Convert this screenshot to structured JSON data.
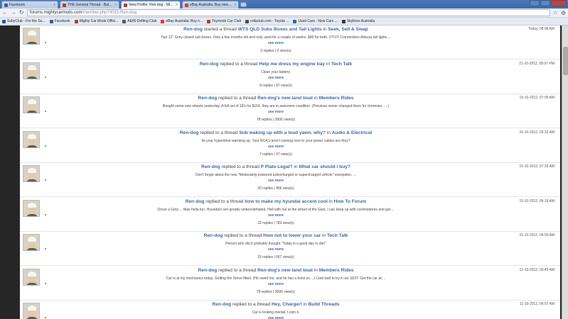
{
  "browser": {
    "tabs": [
      {
        "title": "Facebook",
        "color": "#3b5998"
      },
      {
        "title": "THE General Thread - Baltsy",
        "color": "#b03a2e"
      },
      {
        "title": "View Profile: Ren-dog - Mighty",
        "color": "#b03a2e"
      },
      {
        "title": "eBay Australia: Buy new & u",
        "color": "#e53238"
      }
    ],
    "url_host": "forums.mightycarmods.com",
    "url_path": "/member.php?3032-Ren-dog",
    "bookmarks": [
      {
        "label": "SubyClub - For the Su...",
        "color": "#2a4f9e"
      },
      {
        "label": "Facebook",
        "color": "#3b5998"
      },
      {
        "label": "Mighty Car Mods Offici...",
        "color": "#b03a2e"
      },
      {
        "label": "AE86 Drifting Club",
        "color": "#555555"
      },
      {
        "label": "eBay Australia: Buy n...",
        "color": "#e53238"
      },
      {
        "label": "Toymods Car Club",
        "color": "#c0392b"
      },
      {
        "label": "rollaclub.com - Toyota ...",
        "color": "#4a4a4a"
      },
      {
        "label": "Used Cars - New Cars ...",
        "color": "#1a6fb5"
      },
      {
        "label": "Skylines Australia",
        "color": "#333333"
      }
    ]
  },
  "feed": [
    {
      "user": "Ren-dog",
      "verb": " started a thread ",
      "thread": "WTS QLD Subs Boxes and Tail Lights",
      "in": " in ",
      "forum": "Seek, Sell & Swap",
      "time": "Today, 08:08 AM",
      "snippet": "Two 12\" Sony closed sub boxes. Only a few months old and only used for a couple of weeks. $40 for both. VT/VX Commodore Altezza tail lights....",
      "see_more": "see more",
      "stats": "0 replies | 0 view(s)"
    },
    {
      "user": "Ren-dog",
      "verb": " replied to a thread ",
      "thread": "Help me dress my engine bay",
      "in": " in ",
      "forum": "Tech Talk",
      "time": "21-10-2012, 05:07 PM",
      "snippet": "Clean your battery.",
      "see_more": "see more",
      "stats": "8 replies | 87 view(s)"
    },
    {
      "user": "Ren-dog",
      "verb": " replied to a thread ",
      "thread": "Ren-dog's new land boat",
      "in": " in ",
      "forum": "Members Rides",
      "time": "19-10-2012, 07:05 AM",
      "snippet": "Bought some new wheels yesterday. A full set of 18's for $150, they are in awesome condition. (Previous owner changed them for chromies......)",
      "see_more": "see more",
      "stats": "78 replies | 3006 view(s)"
    },
    {
      "user": "Ren-dog",
      "verb": " replied to a thread ",
      "thread": "Sub waking up with a loud yawn. why?",
      "in": " in ",
      "forum": "Audio & Electrical",
      "time": "16-10-2012, 03:32 AM",
      "snippet": "Its your hyperdrive warming up. Your RCA's aren't running next to your power cables are they?",
      "see_more": "see more",
      "stats": "7 replies | 97 view(s)"
    },
    {
      "user": "Ren-dog",
      "verb": " replied to a thread ",
      "thread": "P Plate Legal?",
      "in": " in ",
      "forum": "What car should I buy?",
      "time": "15-10-2012, 07:33 AM",
      "snippet": "Don't forget about the new \"Moderately-powered turbocharged or supercharged vehicle\" exemption. ...",
      "see_more": "see more",
      "stats": "20 replies | 456 view(s)"
    },
    {
      "user": "Ren-dog",
      "verb": " replied to a thread ",
      "thread": "how to make my hyundai accent cool",
      "in": " in ",
      "forum": "How To Forum",
      "time": "15-10-2012, 05:16 AM",
      "snippet": "Drove a Getz.... Was hella fun. Hyundai's are greatly underestimated. Hell with me at the wheel of the Getz, I can keep up with commodores and get....",
      "see_more": "see more",
      "stats": "32 replies | 783 view(s)"
    },
    {
      "user": "Ren-dog",
      "verb": " replied to a thread ",
      "thread": "How not to lower your car",
      "in": " in ",
      "forum": "Tech Talk",
      "time": "15-10-2012, 04:50 AM",
      "snippet": "Person who did it probably thought \"Today is a good day to die!\"",
      "see_more": "see more",
      "stats": "15 replies | 667 view(s)"
    },
    {
      "user": "Ren-dog",
      "verb": " replied to a thread ",
      "thread": "Ren-dog's new land boat",
      "in": " in ",
      "forum": "Members Rides",
      "time": "12-10-2012, 03:45 AM",
      "snippet": "Car is at my mechanics today, Getting the Servo fitted. (He owed me, and he has a hoist so....) Cant wait to try it out. EDIT: Got the car at....",
      "see_more": "see more",
      "stats": "78 replies | 3006 view(s)"
    },
    {
      "user": "Ren-dog",
      "verb": " replied to a thread ",
      "thread": "Hey, Charger!",
      "in": " in ",
      "forum": "Build Threads",
      "time": "11-10-2012, 06:57 AM",
      "snippet": "Car is looking mental. Lovin it.",
      "see_more": "see more",
      "stats": ""
    }
  ]
}
